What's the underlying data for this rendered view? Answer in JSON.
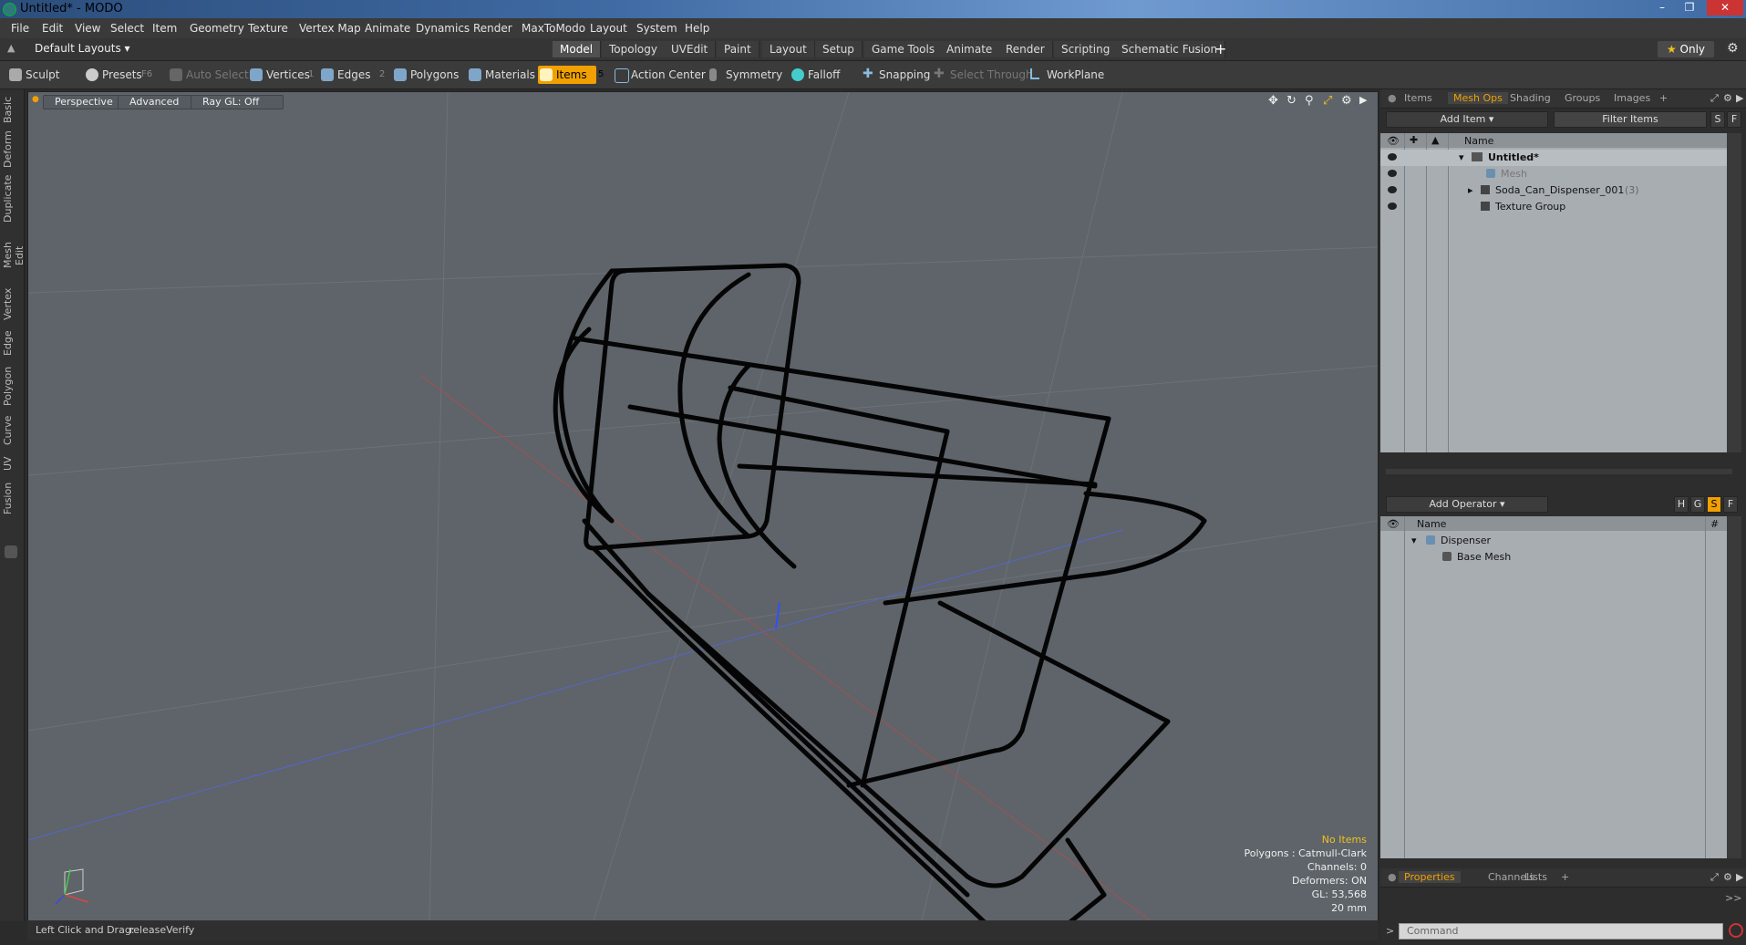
{
  "window": {
    "title": "Untitled* - MODO"
  },
  "menu": [
    "File",
    "Edit",
    "View",
    "Select",
    "Item",
    "Geometry",
    "Texture",
    "Vertex Map",
    "Animate",
    "Dynamics",
    "Render",
    "MaxToModo",
    "Layout",
    "System",
    "Help"
  ],
  "layout": {
    "default_layouts": "Default Layouts",
    "tabs": [
      "Model",
      "Topology",
      "UVEdit",
      "Paint",
      "Layout",
      "Setup",
      "Game Tools",
      "Animate",
      "Render",
      "Scripting",
      "Schematic Fusion"
    ],
    "active_tab": "Model",
    "add": "+",
    "only": "Only"
  },
  "toolbar": {
    "sculpt": "Sculpt",
    "presets": "Presets",
    "presets_key": "F6",
    "auto_select": "Auto Select",
    "vertices": "Vertices",
    "vertices_count": "1",
    "edges": "Edges",
    "edges_count": "2",
    "polygons": "Polygons",
    "materials": "Materials",
    "items": "Items",
    "items_count": "5",
    "action_center": "Action Center",
    "symmetry": "Symmetry",
    "falloff": "Falloff",
    "snapping": "Snapping",
    "select_through": "Select Through",
    "workplane": "WorkPlane"
  },
  "left_tabs": [
    "Basic",
    "Deform",
    "Duplicate",
    "Mesh Edit",
    "Vertex",
    "Edge",
    "Polygon",
    "Curve",
    "UV",
    "Fusion"
  ],
  "viewport": {
    "view": "Perspective",
    "shading": "Advanced",
    "raygl": "Ray GL: Off",
    "info": {
      "no_items": "No Items",
      "polygons": "Polygons : Catmull-Clark",
      "channels": "Channels: 0",
      "deformers": "Deformers: ON",
      "gl": "GL: 53,568",
      "scale": "20 mm"
    }
  },
  "status": {
    "hint": "Left Click and Drag:",
    "action": "releaseVerify"
  },
  "items_panel": {
    "tabs": [
      "Items",
      "Mesh Ops",
      "Shading",
      "Groups",
      "Images"
    ],
    "active_tab": "Mesh Ops",
    "add_item": "Add Item",
    "filter": "Filter Items",
    "s": "S",
    "f": "F",
    "header": "Name",
    "rows": [
      {
        "label": "Untitled*"
      },
      {
        "label": "Mesh"
      },
      {
        "label": "Soda_Can_Dispenser_001",
        "count": "(3)"
      },
      {
        "label": "Texture Group"
      }
    ]
  },
  "ops_panel": {
    "add_operator": "Add Operator",
    "h": "H",
    "g": "G",
    "s": "S",
    "f": "F",
    "header": "Name",
    "hash": "#",
    "rows": [
      {
        "label": "Dispenser"
      },
      {
        "label": "Base Mesh"
      }
    ]
  },
  "props_panel": {
    "tabs": [
      "Properties",
      "Channels",
      "Lists"
    ],
    "active_tab": "Properties",
    "command_placeholder": "Command"
  },
  "colors": {
    "accent": "#f0a000",
    "viewport_bg": "#5e6469"
  }
}
